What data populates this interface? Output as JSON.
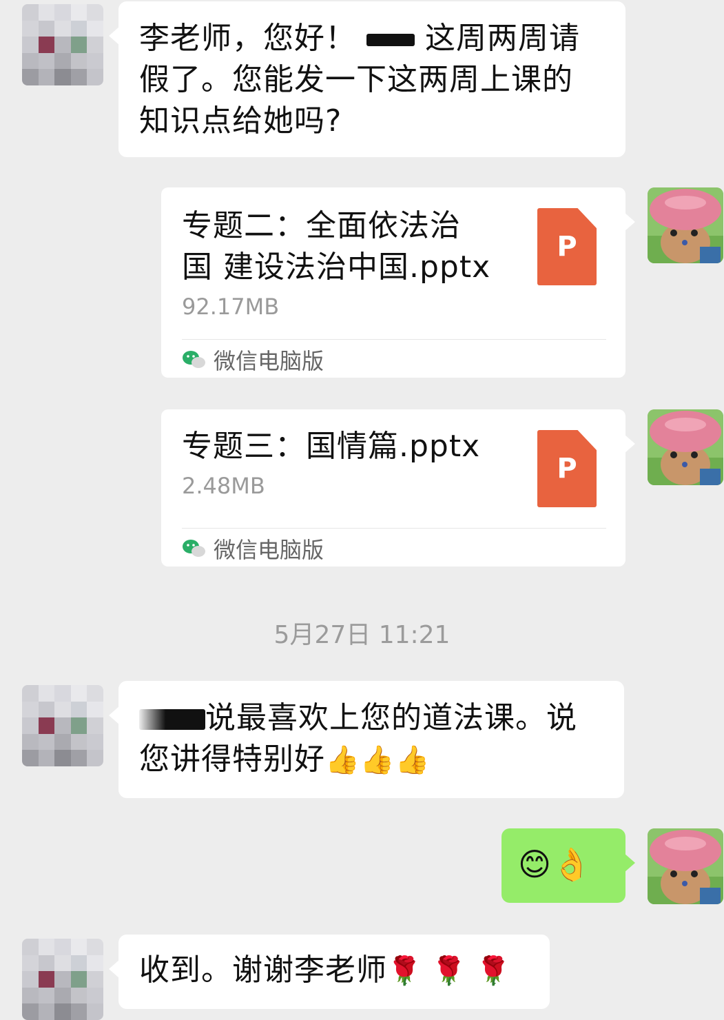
{
  "messages": {
    "m1_text": "李老师，您好！ 这周两周请假了。您能发一下这两周上课的知识点给她吗？",
    "m1_line1": "李老师，您好！",
    "m1_line1b": "这周两周请",
    "m1_line2": "假了。您能发一下这两周上课的",
    "m1_line3": "知识点给她吗?",
    "file1": {
      "title_line1": "专题二：全面依法治",
      "title_line2": "国 建设法治中国.pptx",
      "size": "92.17MB",
      "source": "微信电脑版",
      "icon_letter": "P"
    },
    "file2": {
      "title_line1": "专题三：国情篇.pptx",
      "size": "2.48MB",
      "source": "微信电脑版",
      "icon_letter": "P"
    },
    "timestamp": "5月27日 11:21",
    "m2_line1": "说最喜欢上您的道法课。说",
    "m2_line2": "您讲得特别好",
    "m2_emojis": "👍👍👍",
    "m3_emojis": "😊👌",
    "m4_text": "收到。谢谢李老师",
    "m4_emojis": "🌹 🌹 🌹"
  },
  "colors": {
    "background": "#ededed",
    "bubble_white": "#ffffff",
    "bubble_green": "#95ec69",
    "ppt_orange": "#e8633f",
    "wechat_green": "#2aae67"
  },
  "icons": {
    "file_icon": "powerpoint-file-icon",
    "source_icon": "wechat-logo-icon"
  }
}
